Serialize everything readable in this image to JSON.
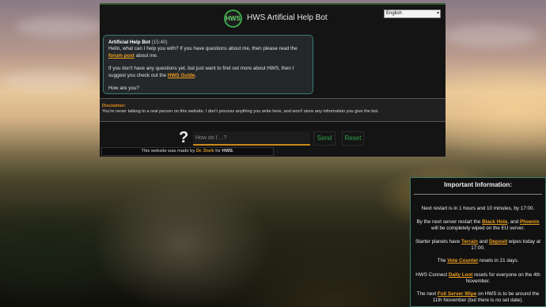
{
  "app": {
    "title": "HWS Artificial Help Bot",
    "logo_text": "HWS",
    "language": "English"
  },
  "chat": {
    "bot_name": "Artificial Help Bot",
    "time": "(15:40)",
    "line1": "Hello, what can I help you with? If you have questions about me, then please read the",
    "forum_link": "forum post",
    "line1_end": "about me.",
    "line2": "If you don't have any questions yet, but just want to find out more about HWS, then I suggest you check out the",
    "guide_link": "HWS Guide",
    "line2_end": ".",
    "line3": "How are you?"
  },
  "disclaimer": {
    "title": "Disclaimer:",
    "text": "You're never talking to a real person on this website. I don't process anything you write here, and won't store any information you give the bot."
  },
  "input": {
    "placeholder": "How do I ...?",
    "value": "",
    "send_label": "Send",
    "reset_label": "Reset"
  },
  "footer": {
    "prefix": "This website was made by",
    "author": "Dr. Dork",
    "middle": "for",
    "org": "HWS",
    "end": "."
  },
  "info": {
    "title": "Important Information:",
    "restart": "Next restart is in 1 hours and 10 minutes, by 17:00.",
    "wipe_a": "By the next server restart the",
    "black_hole": "Black Hole",
    "wipe_b": ", and",
    "phoenix": "Phoenix",
    "wipe_c": "will be completely wiped on the EU server.",
    "starter_a": "Starter planets have",
    "terrain": "Terrain",
    "starter_b": "and",
    "deposit": "Deposit",
    "starter_c": "wipes today at 17:00.",
    "vote_a": "The",
    "vote_counter": "Vote Counter",
    "vote_b": "resets in 21 days.",
    "loot_a": "HWS Connect",
    "daily_loot": "Daily Loot",
    "loot_b": "resets for everyone on the 4th November.",
    "full_a": "The next",
    "full_wipe": "Full Server Wipe",
    "full_b": "on HWS is to be around the 11th November (but there is no set date)."
  },
  "colors": {
    "accent": "#2fa84a",
    "link": "#f0a020",
    "panel_bg": "#141414",
    "bubble_border": "#3a7a74"
  }
}
